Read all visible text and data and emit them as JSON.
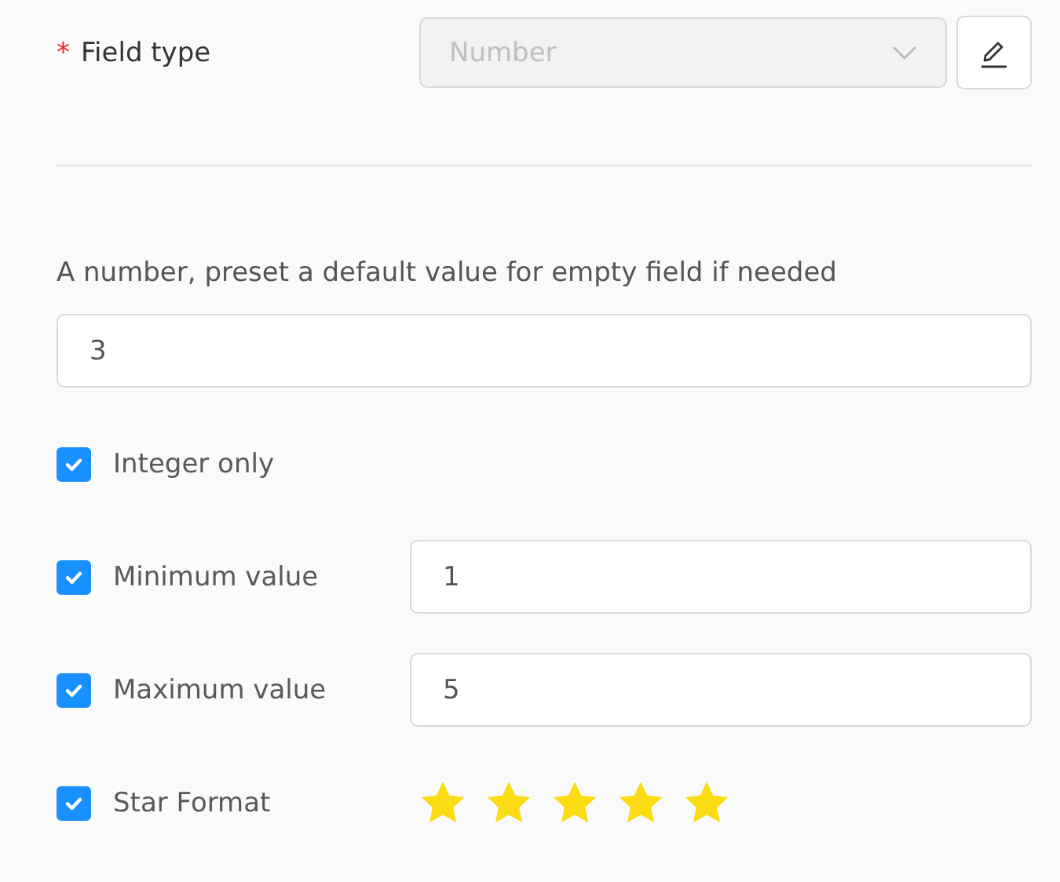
{
  "field_type": {
    "label": "Field type",
    "required_mark": "*",
    "value": "Number",
    "disabled": true
  },
  "default_value": {
    "label": "A number, preset a default value for empty field if needed",
    "value": "3"
  },
  "options": [
    {
      "kind": "checkbox",
      "label": "Integer only",
      "checked": true
    },
    {
      "kind": "number",
      "label": "Minimum value",
      "checked": true,
      "value": "1"
    },
    {
      "kind": "number",
      "label": "Maximum value",
      "checked": true,
      "value": "5"
    },
    {
      "kind": "stars",
      "label": "Star Format",
      "checked": true,
      "stars": 5
    }
  ]
}
